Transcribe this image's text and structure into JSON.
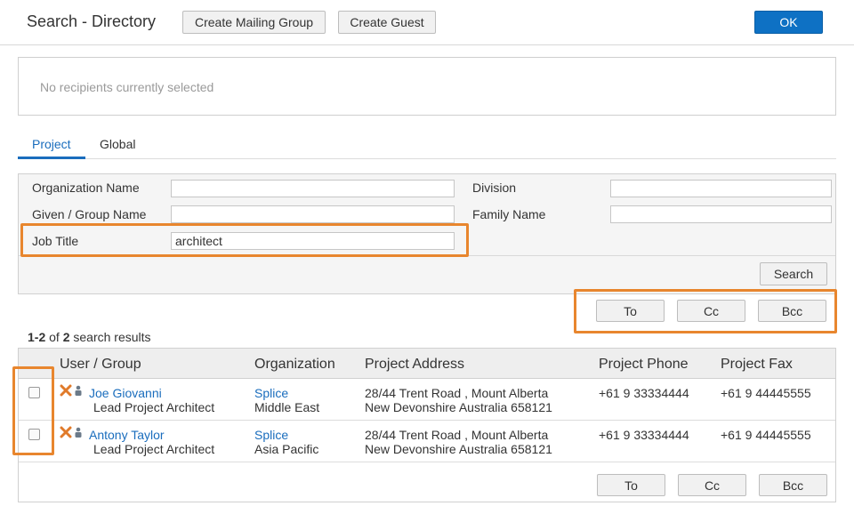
{
  "header": {
    "title": "Search - Directory",
    "create_mailing_group": "Create Mailing Group",
    "create_guest": "Create Guest",
    "ok": "OK"
  },
  "recipients": {
    "empty_text": "No recipients currently selected"
  },
  "tabs": [
    {
      "label": "Project",
      "active": true
    },
    {
      "label": "Global",
      "active": false
    }
  ],
  "form": {
    "organization_name": {
      "label": "Organization Name",
      "value": ""
    },
    "division": {
      "label": "Division",
      "value": ""
    },
    "given_group_name": {
      "label": "Given / Group Name",
      "value": ""
    },
    "family_name": {
      "label": "Family Name",
      "value": ""
    },
    "job_title": {
      "label": "Job Title",
      "value": "architect"
    },
    "search_button": "Search"
  },
  "actions": {
    "to": "To",
    "cc": "Cc",
    "bcc": "Bcc"
  },
  "results": {
    "range": "1-2",
    "of": "of",
    "total": "2",
    "suffix": "search results"
  },
  "table": {
    "columns": [
      "User / Group",
      "Organization",
      "Project Address",
      "Project Phone",
      "Project Fax"
    ],
    "rows": [
      {
        "name": "Joe Giovanni",
        "role": "Lead Project Architect",
        "org": "Splice",
        "org_division": "Middle East",
        "address_line1": "28/44 Trent Road , Mount Alberta",
        "address_line2": "New Devonshire Australia 658121",
        "phone": "+61 9 33334444",
        "fax": "+61 9 44445555"
      },
      {
        "name": "Antony Taylor",
        "role": "Lead Project Architect",
        "org": "Splice",
        "org_division": "Asia Pacific",
        "address_line1": "28/44 Trent Road , Mount Alberta",
        "address_line2": "New Devonshire Australia 658121",
        "phone": "+61 9 33334444",
        "fax": "+61 9 44445555"
      }
    ]
  },
  "colors": {
    "accent": "#0e71c4",
    "link": "#1a6dbd",
    "highlight": "#e8862e",
    "icon_x": "#e07a2a",
    "icon_person": "#6b7a89"
  }
}
